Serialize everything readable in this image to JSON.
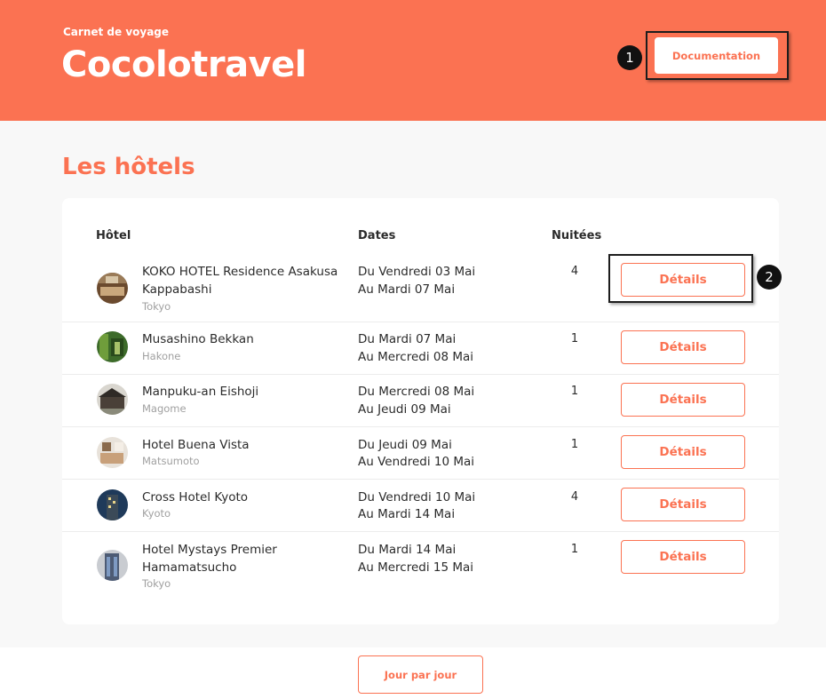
{
  "header": {
    "subtitle": "Carnet de voyage",
    "title": "Cocolotravel",
    "doc_button": "Documentation"
  },
  "markers": {
    "m1": "1",
    "m2": "2"
  },
  "section_title": "Les hôtels",
  "table": {
    "columns": {
      "hotel": "Hôtel",
      "dates": "Dates",
      "nights": "Nuitées"
    },
    "rows": [
      {
        "name": "KOKO HOTEL Residence Asakusa Kappabashi",
        "city": "Tokyo",
        "from": "Du Vendredi 03 Mai",
        "to": "Au Mardi 07 Mai",
        "nights": "4",
        "button": "Détails"
      },
      {
        "name": "Musashino Bekkan",
        "city": "Hakone",
        "from": "Du Mardi 07 Mai",
        "to": "Au Mercredi 08 Mai",
        "nights": "1",
        "button": "Détails"
      },
      {
        "name": "Manpuku-an Eishoji",
        "city": "Magome",
        "from": "Du Mercredi 08 Mai",
        "to": "Au Jeudi 09 Mai",
        "nights": "1",
        "button": "Détails"
      },
      {
        "name": "Hotel Buena Vista",
        "city": "Matsumoto",
        "from": "Du Jeudi 09 Mai",
        "to": "Au Vendredi 10 Mai",
        "nights": "1",
        "button": "Détails"
      },
      {
        "name": "Cross Hotel Kyoto",
        "city": "Kyoto",
        "from": "Du Vendredi 10 Mai",
        "to": "Au Mardi 14 Mai",
        "nights": "4",
        "button": "Détails"
      },
      {
        "name": "Hotel Mystays Premier Hamamatsucho",
        "city": "Tokyo",
        "from": "Du Mardi 14 Mai",
        "to": "Au Mercredi 15 Mai",
        "nights": "1",
        "button": "Détails"
      }
    ]
  },
  "footer": {
    "day_button": "Jour par jour"
  },
  "colors": {
    "accent": "#fb7252",
    "background": "#f8f8f8",
    "card": "#ffffff"
  }
}
